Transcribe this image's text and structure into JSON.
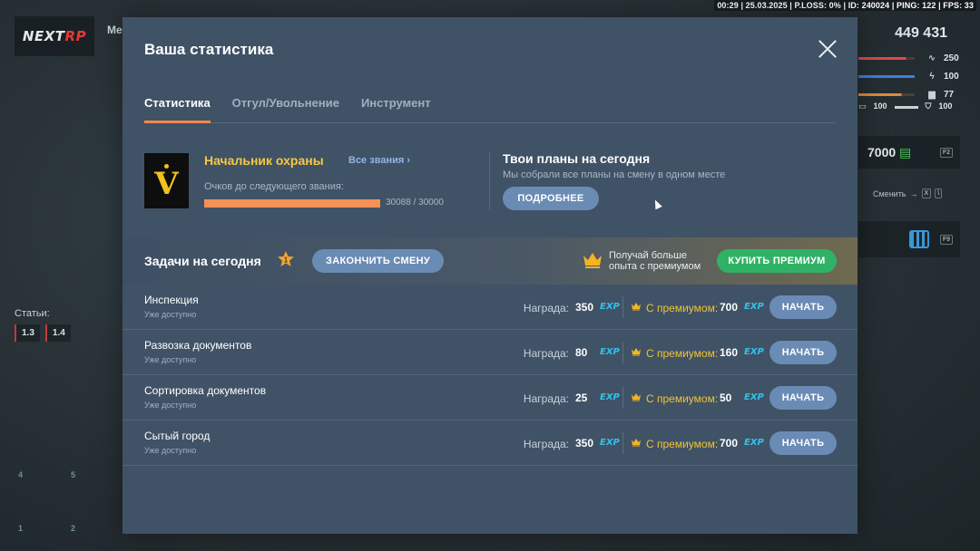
{
  "hud": {
    "top_info": "00:29 | 25.03.2025 | P.LOSS: 0% | ID: 240024 | PING: 122 | FPS: 33",
    "logo_main": "NEXT",
    "logo_accent": "RP",
    "menu_stub": "Me",
    "money": "449 431",
    "stats": [
      {
        "icon": "heartbeat-icon",
        "value": "250",
        "color": "#e04848",
        "fill": 0.85
      },
      {
        "icon": "lightning-icon",
        "value": "100",
        "color": "#3d7ee0",
        "fill": 1.0
      },
      {
        "icon": "food-icon",
        "value": "77",
        "color": "#e08a3a",
        "fill": 0.77
      }
    ],
    "armor_left": "100",
    "armor_right": "100",
    "cash": "7000",
    "cash_key": "F2",
    "change_label": "Сменить",
    "change_key1": "X",
    "change_key2": "\\",
    "calendar_key": "F9",
    "articles_label": "Статьи:",
    "articles": [
      "1.3",
      "1.4"
    ],
    "slots": [
      "4",
      "5",
      "1",
      "2"
    ]
  },
  "modal": {
    "title": "Ваша статистика",
    "tabs": [
      "Статистика",
      "Отгул/Увольнение",
      "Инструмент"
    ],
    "active_tab": 0
  },
  "rank": {
    "name": "Начальник охраны",
    "all_ranks": "Все звания ›",
    "points_label": "Очков до следующего звания:",
    "progress_text": "30088 / 30000",
    "progress_fraction": 1.0,
    "badge_symbol": "V"
  },
  "plans": {
    "title": "Твои планы на сегодня",
    "subtitle": "Мы собрали все планы на смену в одном месте",
    "button": "ПОДРОБНЕЕ"
  },
  "tasks_header": {
    "title": "Задачи на сегодня",
    "star_number": "1",
    "finish_button": "ЗАКОНЧИТЬ СМЕНУ",
    "premium_line1": "Получай больше",
    "premium_line2": "опыта с премиумом",
    "premium_button": "КУПИТЬ ПРЕМИУМ"
  },
  "task_labels": {
    "reward": "Награда:",
    "premium": "С премиумом:",
    "exp": "EXP",
    "start": "НАЧАТЬ"
  },
  "tasks": [
    {
      "name": "Инспекция",
      "status": "Уже доступно",
      "reward": "350",
      "premium_reward": "700"
    },
    {
      "name": "Развозка документов",
      "status": "Уже доступно",
      "reward": "80",
      "premium_reward": "160"
    },
    {
      "name": "Сортировка документов",
      "status": "Уже доступно",
      "reward": "25",
      "premium_reward": "50"
    },
    {
      "name": "Сытый город",
      "status": "Уже доступно",
      "reward": "350",
      "premium_reward": "700"
    }
  ],
  "colors": {
    "accent_orange": "#f39157",
    "rank_gold": "#f6c83f",
    "exp_blue": "#36c0ea",
    "premium_green": "#2fb266",
    "button_blue": "#6a8bb4",
    "modal_bg": "#405266"
  }
}
